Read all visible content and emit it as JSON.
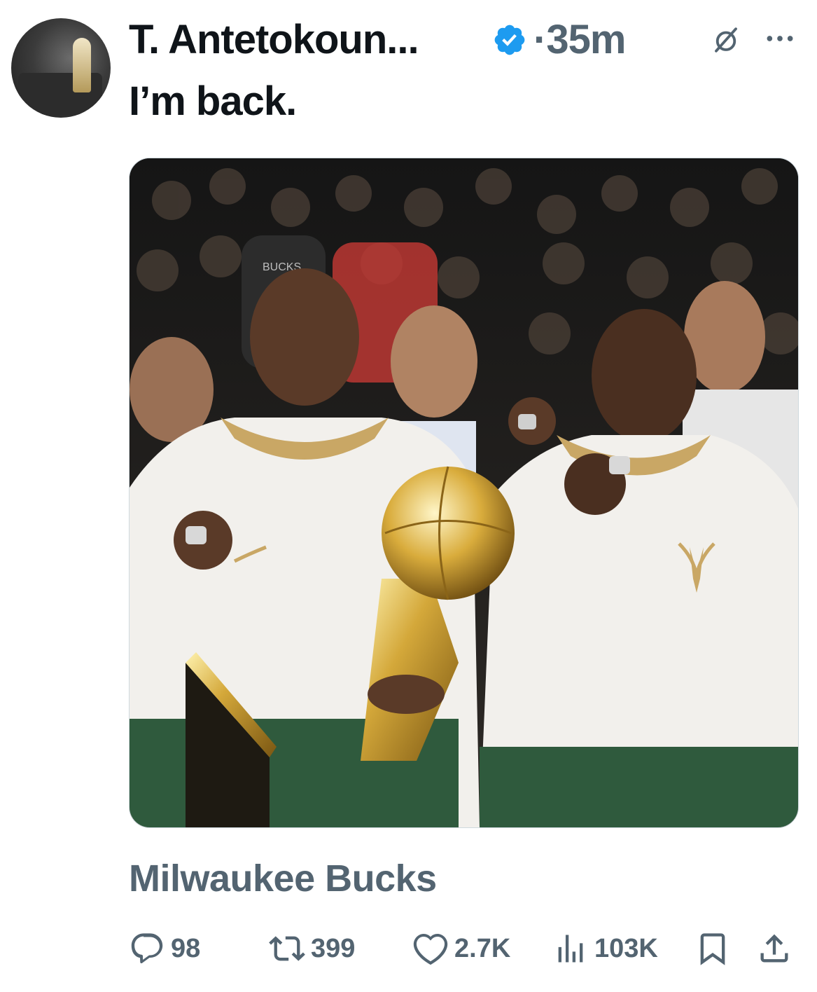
{
  "post": {
    "author_name": "T. Antetokoun...",
    "timestamp": "35m",
    "separator": "·",
    "text": "I’m back.",
    "card_title": "Milwaukee Bucks"
  },
  "media": {
    "shirt_text": "BUCKS"
  },
  "metrics": {
    "replies": "98",
    "reposts": "399",
    "likes": "2.7K",
    "views": "103K"
  },
  "icons": {
    "verified": "verified-badge-icon",
    "grok": "grok-icon",
    "more": "more-icon",
    "reply": "reply-icon",
    "repost": "repost-icon",
    "like": "like-icon",
    "views": "views-icon",
    "bookmark": "bookmark-icon",
    "share": "share-icon"
  },
  "colors": {
    "text_primary": "#0f1419",
    "text_secondary": "#536471",
    "verified_blue": "#1d9bf0",
    "bucks_green": "#2f5a3d",
    "hoodie_white": "#f2f0ec",
    "trophy_gold": "#d4a83a"
  }
}
